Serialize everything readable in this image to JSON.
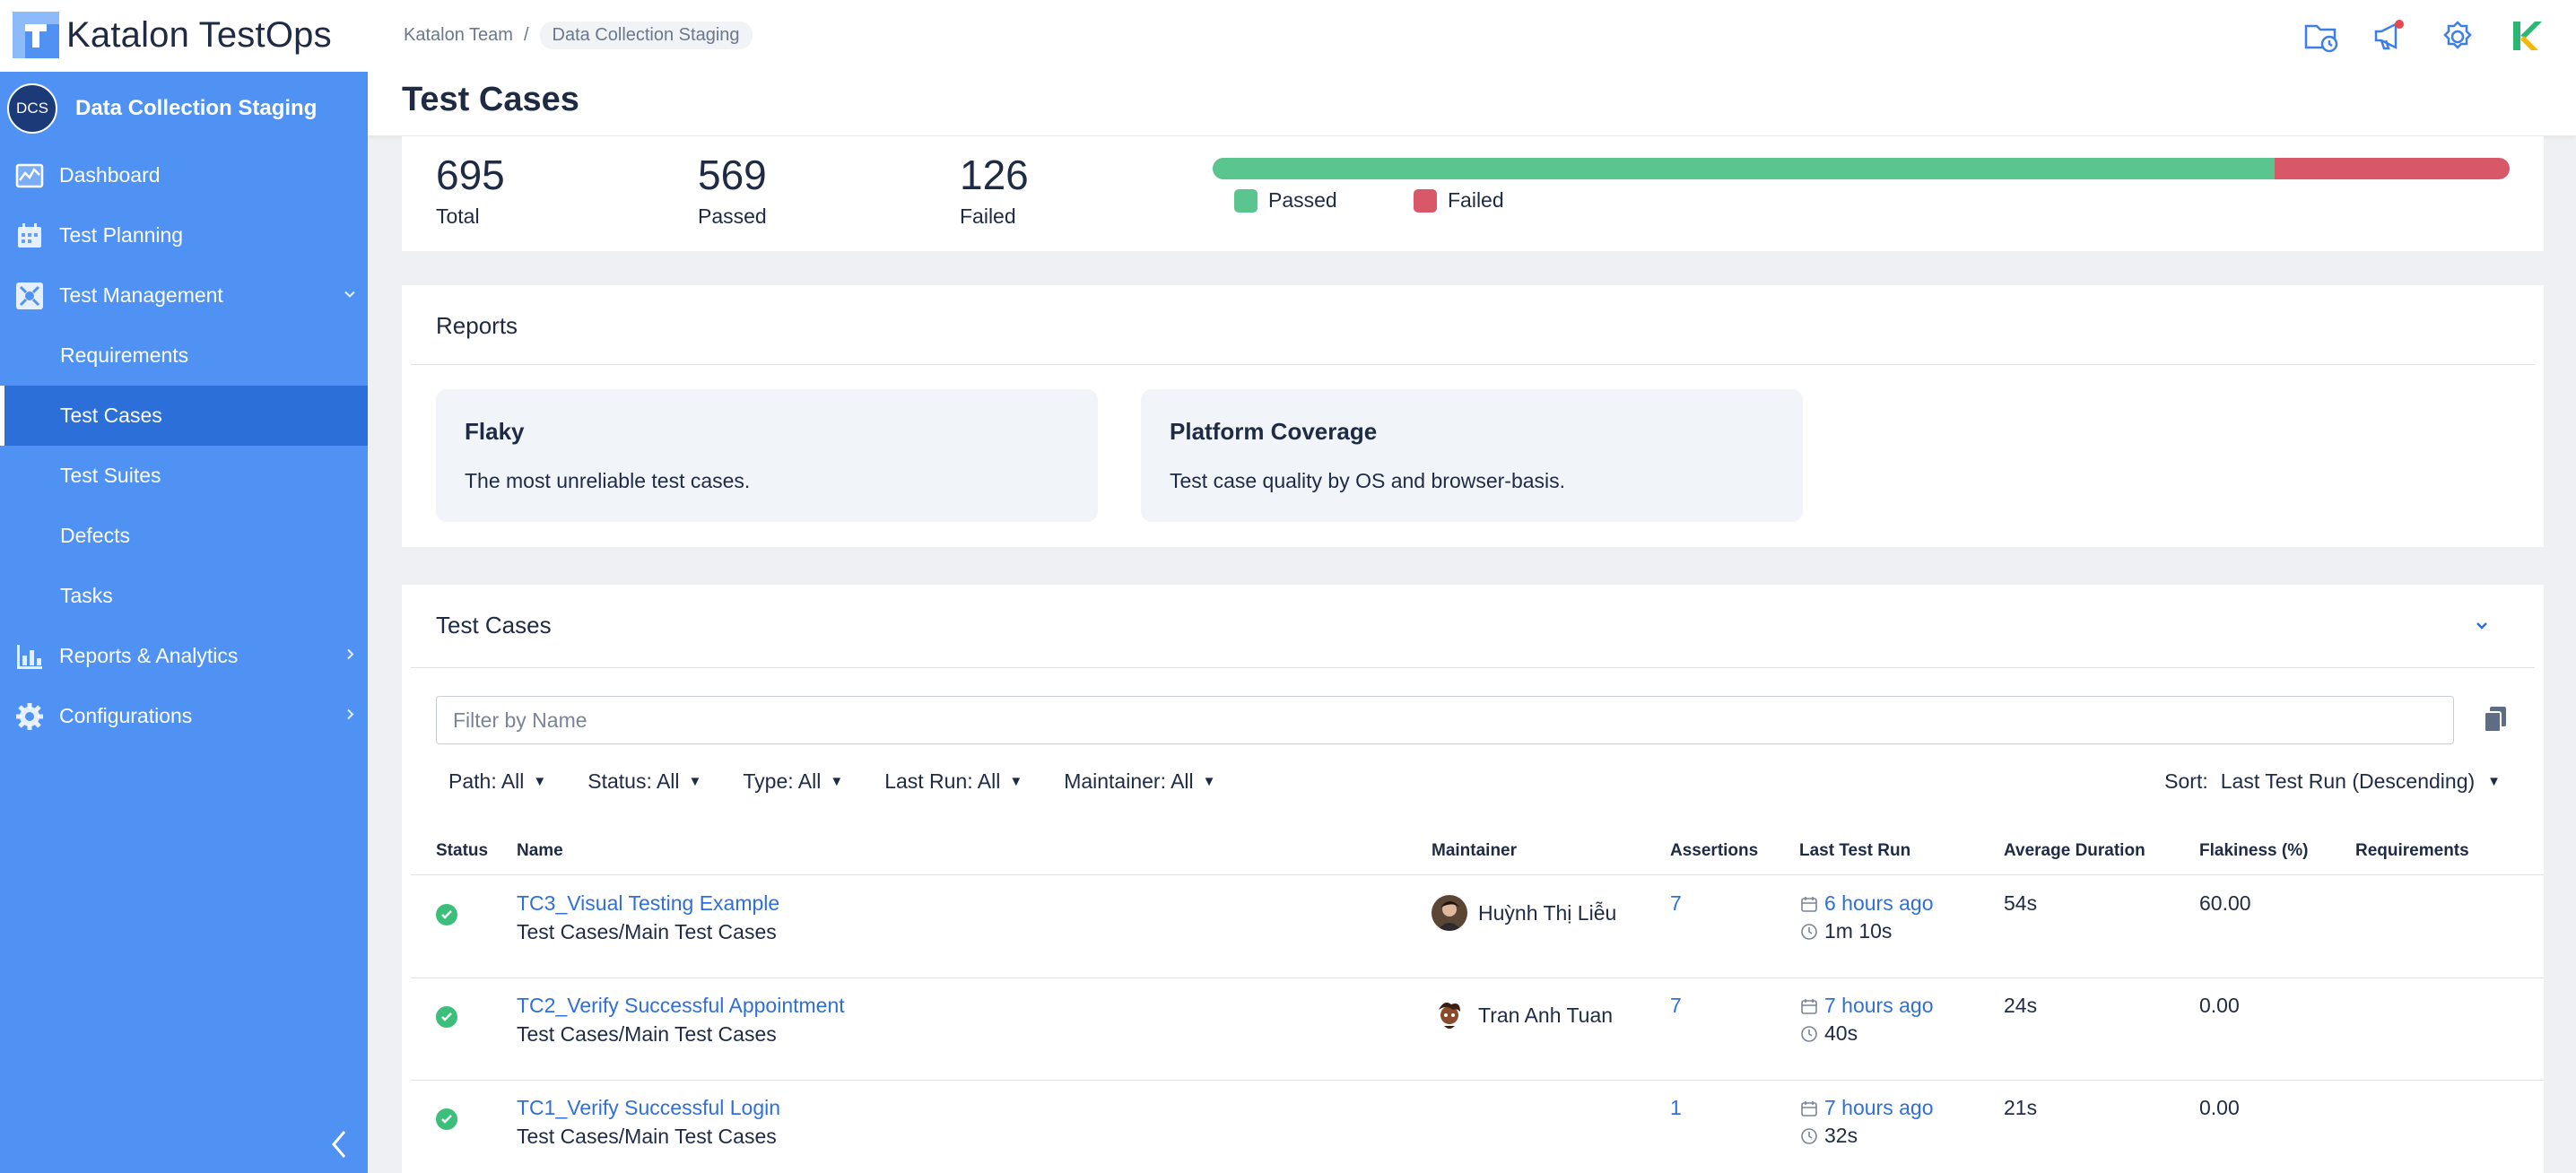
{
  "app": {
    "brand_name": "Katalon TestOps",
    "colors": {
      "accent": "#4f92f4",
      "passed": "#5ac58e",
      "failed": "#d95868",
      "link": "#2f6fdb"
    }
  },
  "breadcrumb": {
    "team": "Katalon Team",
    "separator": "/",
    "project": "Data Collection Staging"
  },
  "top_icons": [
    "folder-clock-icon",
    "megaphone-icon",
    "gear-icon",
    "katalon-k-icon"
  ],
  "sidebar": {
    "project_initials": "DCS",
    "project_name": "Data Collection Staging",
    "items": [
      {
        "label": "Dashboard",
        "icon": "dashboard-icon"
      },
      {
        "label": "Test Planning",
        "icon": "calendar-icon"
      },
      {
        "label": "Test Management",
        "icon": "test-management-icon"
      },
      {
        "label": "Requirements"
      },
      {
        "label": "Test Cases"
      },
      {
        "label": "Test Suites"
      },
      {
        "label": "Defects"
      },
      {
        "label": "Tasks"
      },
      {
        "label": "Reports & Analytics",
        "icon": "bar-chart-icon"
      },
      {
        "label": "Configurations",
        "icon": "gear-icon"
      }
    ],
    "active": "Test Cases"
  },
  "page": {
    "title": "Test Cases"
  },
  "summary": {
    "total": "695",
    "total_label": "Total",
    "passed": "569",
    "passed_label": "Passed",
    "failed": "126",
    "failed_label": "Failed",
    "passed_fraction": 0.8187,
    "legend_passed": "Passed",
    "legend_failed": "Failed"
  },
  "reports": {
    "title": "Reports",
    "tiles": [
      {
        "title": "Flaky",
        "desc": "The most unreliable test cases."
      },
      {
        "title": "Platform Coverage",
        "desc": "Test case quality by OS and browser-basis."
      }
    ]
  },
  "test_cases": {
    "title": "Test Cases",
    "filter_placeholder": "Filter by Name",
    "filters": [
      "Path: All",
      "Status: All",
      "Type: All",
      "Last Run: All",
      "Maintainer: All"
    ],
    "sort_label": "Sort:",
    "sort_value": "Last Test Run (Descending)",
    "columns": [
      "Status",
      "Name",
      "Maintainer",
      "Assertions",
      "Last Test Run",
      "Average Duration",
      "Flakiness (%)",
      "Requirements"
    ],
    "rows": [
      {
        "status": "passed",
        "name": "TC3_Visual Testing Example",
        "path": "Test Cases/Main Test Cases",
        "maintainer": "Huỳnh Thị Liễu",
        "assertions": "7",
        "last_run": "6 hours ago",
        "run_duration": "1m 10s",
        "avg_duration": "54s",
        "flakiness": "60.00",
        "requirements": ""
      },
      {
        "status": "passed",
        "name": "TC2_Verify Successful Appointment",
        "path": "Test Cases/Main Test Cases",
        "maintainer": "Tran Anh Tuan",
        "assertions": "7",
        "last_run": "7 hours ago",
        "run_duration": "40s",
        "avg_duration": "24s",
        "flakiness": "0.00",
        "requirements": ""
      },
      {
        "status": "passed",
        "name": "TC1_Verify Successful Login",
        "path": "Test Cases/Main Test Cases",
        "maintainer": "",
        "assertions": "1",
        "last_run": "7 hours ago",
        "run_duration": "32s",
        "avg_duration": "21s",
        "flakiness": "0.00",
        "requirements": ""
      }
    ]
  }
}
